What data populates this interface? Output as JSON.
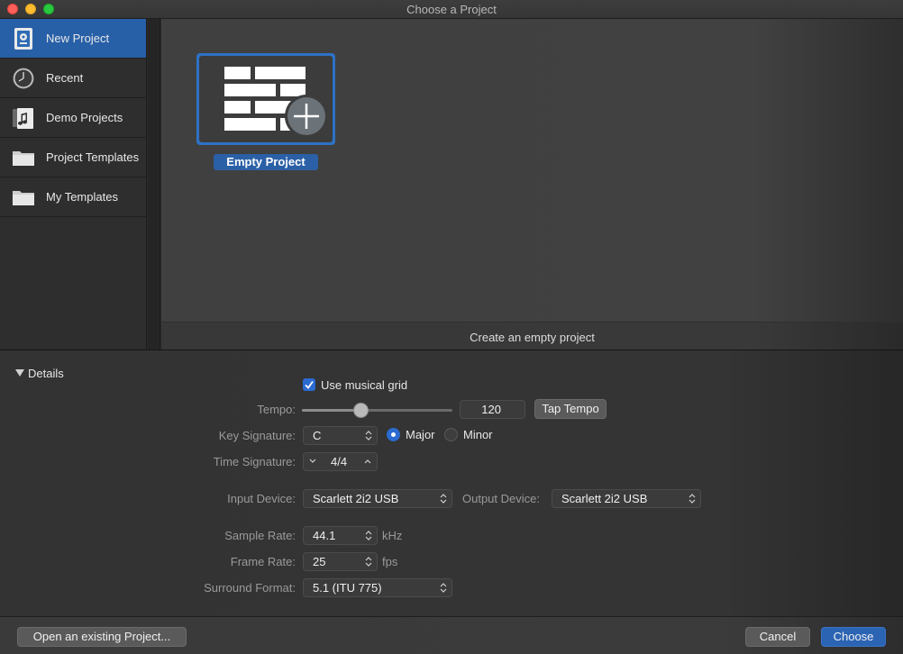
{
  "window": {
    "title": "Choose a Project"
  },
  "sidebar": {
    "items": [
      {
        "label": "New Project",
        "icon": "new-project-icon",
        "selected": true
      },
      {
        "label": "Recent",
        "icon": "clock-icon",
        "selected": false
      },
      {
        "label": "Demo Projects",
        "icon": "music-document-icon",
        "selected": false
      },
      {
        "label": "Project Templates",
        "icon": "folder-icon",
        "selected": false
      },
      {
        "label": "My Templates",
        "icon": "folder-icon",
        "selected": false
      }
    ]
  },
  "browser": {
    "tile_label": "Empty Project",
    "tile_icon": "empty-project-plus-icon",
    "description": "Create an empty project"
  },
  "details": {
    "toggle_label": "Details",
    "use_musical_grid": {
      "label": "Use musical grid",
      "checked": true
    },
    "tempo": {
      "label": "Tempo:",
      "value": "120",
      "slider_fraction": 0.38,
      "tap_button": "Tap Tempo"
    },
    "key_signature": {
      "label": "Key Signature:",
      "value": "C",
      "major_label": "Major",
      "minor_label": "Minor",
      "mode": "Major"
    },
    "time_signature": {
      "label": "Time Signature:",
      "value": "4/4"
    },
    "input_device": {
      "label": "Input Device:",
      "value": "Scarlett 2i2 USB"
    },
    "output_device": {
      "label": "Output Device:",
      "value": "Scarlett 2i2 USB"
    },
    "sample_rate": {
      "label": "Sample Rate:",
      "value": "44.1",
      "unit": "kHz"
    },
    "frame_rate": {
      "label": "Frame Rate:",
      "value": "25",
      "unit": "fps"
    },
    "surround_format": {
      "label": "Surround Format:",
      "value": "5.1 (ITU 775)"
    }
  },
  "footer": {
    "open_existing": "Open an existing Project...",
    "cancel": "Cancel",
    "choose": "Choose"
  },
  "colors": {
    "accent": "#2c64b4",
    "selection": "#2860a8"
  }
}
